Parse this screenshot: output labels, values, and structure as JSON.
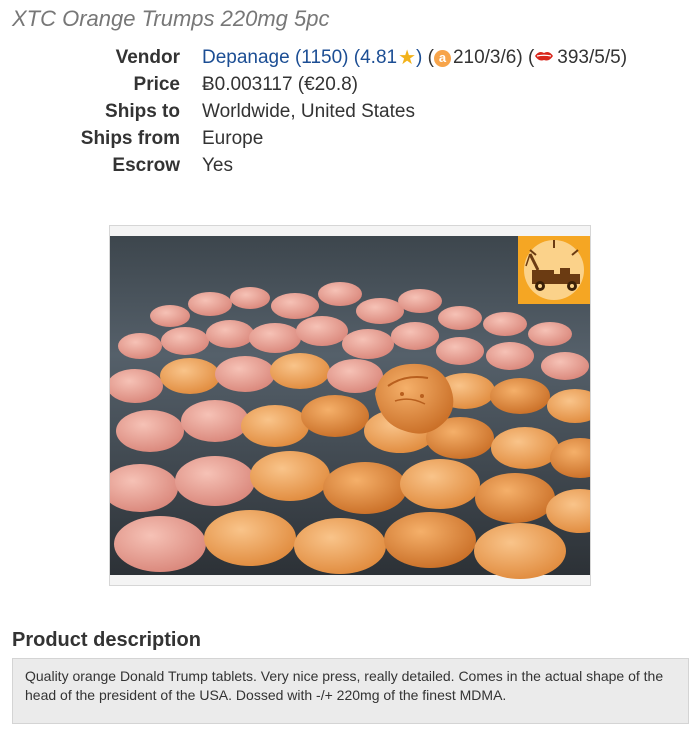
{
  "listing": {
    "title": "XTC Orange Trumps 220mg 5pc"
  },
  "info": {
    "vendor": {
      "label": "Vendor",
      "name": "Depanage (1150)",
      "rating": "(4.81",
      "rating_close": ")",
      "star_icon": "star-icon",
      "ext1_open": "(",
      "ext1_icon": "a",
      "ext1_value": "210/3/6)",
      "ext2_open": "(",
      "ext2_value": "393/5/5)"
    },
    "price": {
      "label": "Price",
      "value": "Ƀ0.003117 (€20.8)"
    },
    "ships_to": {
      "label": "Ships to",
      "value": "Worldwide, United States"
    },
    "ships_from": {
      "label": "Ships from",
      "value": "Europe"
    },
    "escrow": {
      "label": "Escrow",
      "value": "Yes"
    }
  },
  "product_image": {
    "subject": "pile of orange and pink pressed tablets shaped like a head",
    "logo_icon": "tow-truck-icon"
  },
  "description": {
    "heading": "Product description",
    "text": "Quality orange Donald Trump tablets. Very nice press, really detailed. Comes in the actual shape of the head of the president of the USA. Dossed with -/+ 220mg of the finest MDMA."
  },
  "colors": {
    "link": "#1c4e94",
    "star": "#f2b21a",
    "badge_a": "#f7a44a",
    "badge_lips": "#d9261c",
    "logo_bg": "#f5a623"
  }
}
